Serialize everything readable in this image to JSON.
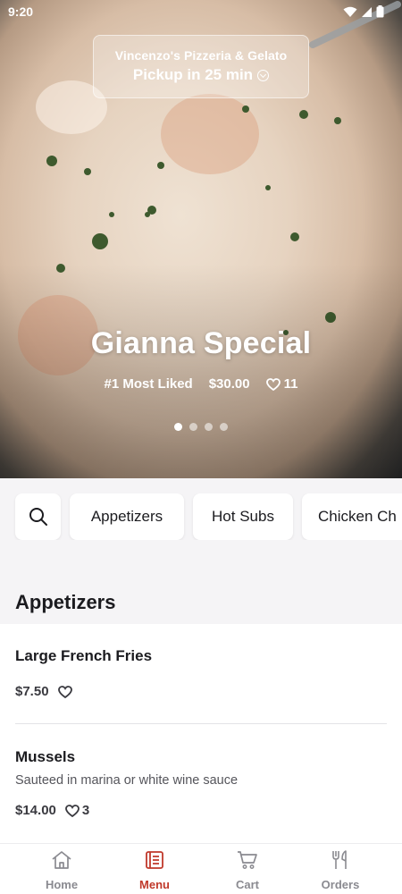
{
  "status_bar": {
    "time": "9:20"
  },
  "store": {
    "name": "Vincenzo's Pizzeria & Gelato",
    "pickup": "Pickup in 25 min"
  },
  "featured": {
    "title": "Gianna Special",
    "badge": "#1 Most Liked",
    "price": "$30.00",
    "likes": "11",
    "carousel_count": 4,
    "carousel_active": 1
  },
  "categories": [
    "Appetizers",
    "Hot Subs",
    "Chicken Ch"
  ],
  "section": {
    "title": "Appetizers"
  },
  "items": [
    {
      "name": "Large French Fries",
      "description": "",
      "price": "$7.50",
      "likes": ""
    },
    {
      "name": "Mussels",
      "description": "Sauteed in marina or white wine sauce",
      "price": "$14.00",
      "likes": "3"
    }
  ],
  "nav": {
    "home": "Home",
    "menu": "Menu",
    "cart": "Cart",
    "orders": "Orders",
    "active": "menu"
  },
  "colors": {
    "accent": "#c0392b"
  }
}
